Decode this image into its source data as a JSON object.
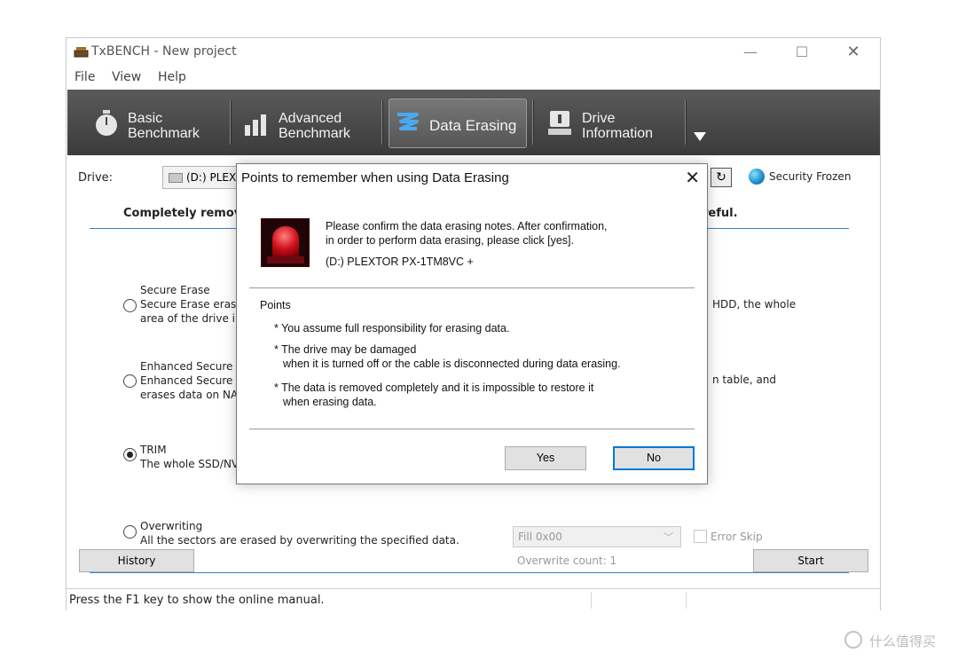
{
  "window": {
    "title": "TxBENCH - New project",
    "controls": {
      "minimize": "—",
      "maximize": "☐",
      "close": "✕"
    }
  },
  "menu": [
    "File",
    "View",
    "Help"
  ],
  "toolbar": {
    "tabs": [
      {
        "line1": "Basic",
        "line2": "Benchmark",
        "icon": "stopwatch-icon"
      },
      {
        "line1": "Advanced",
        "line2": "Benchmark",
        "icon": "bar-chart-icon"
      },
      {
        "line1": "Data Erasing",
        "line2": "",
        "icon": "eraser-zigzag-icon",
        "active": true
      },
      {
        "line1": "Drive",
        "line2": "Information",
        "icon": "drive-info-icon"
      }
    ],
    "dropdown_icon": "triangle-down-icon"
  },
  "drive": {
    "label": "Drive:",
    "selected": "(D:) PLEXTOR PX-1TM8VC +",
    "status": "Security Frozen"
  },
  "section": {
    "title": "Completely remov",
    "title_tail": "reful."
  },
  "options": [
    {
      "name": "Secure Erase",
      "line2": "Secure Erase eras",
      "line3": "area of the drive i",
      "tail": "HDD, the whole",
      "checked": false
    },
    {
      "name": "Enhanced Secure",
      "line2": "Enhanced Secure",
      "line3": "erases data on NA",
      "tail": "n table, and",
      "checked": false
    },
    {
      "name": "TRIM",
      "line2": "The whole SSD/NV",
      "line3": "",
      "tail": "",
      "checked": true
    },
    {
      "name": "Overwriting",
      "line2": "All the sectors are erased by overwriting the specified data.",
      "line3": "",
      "tail": "",
      "checked": false
    }
  ],
  "overwrite": {
    "fill_value": "Fill 0x00",
    "error_skip": "Error Skip",
    "count": "Overwrite count: 1"
  },
  "buttons": {
    "history": "History",
    "start": "Start"
  },
  "status": {
    "text": "Press the F1 key to show the online manual."
  },
  "dialog": {
    "title": "Points to remember when using Data Erasing",
    "confirm_line1": "Please confirm the data erasing notes. After confirmation,",
    "confirm_line2": "in order to perform data erasing, please click [yes].",
    "drive": "(D:) PLEXTOR PX-1TM8VC +",
    "points_title": "Points",
    "points": [
      {
        "l1": "* You assume full responsibility for erasing data.",
        "l2": ""
      },
      {
        "l1": "* The drive may be damaged",
        "l2": "when it is turned off or the cable is disconnected during data erasing."
      },
      {
        "l1": "* The data is removed completely and it is impossible to restore it",
        "l2": "when erasing data."
      }
    ],
    "yes": "Yes",
    "no": "No"
  },
  "watermark": "什么值得买"
}
